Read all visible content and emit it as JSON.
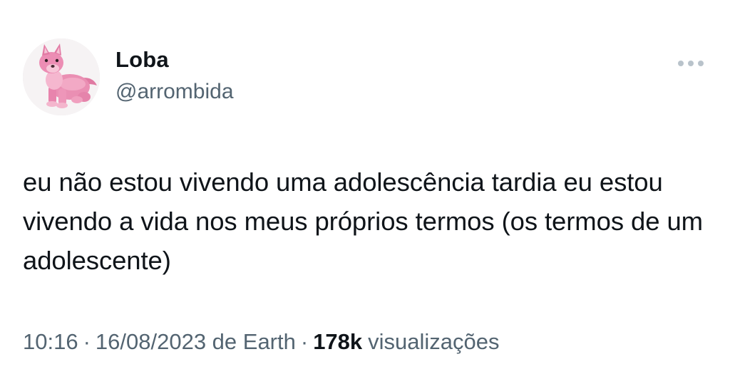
{
  "author": {
    "display_name": "Loba",
    "handle": "@arrombida",
    "avatar_icon": "pink-plush-wolf-avatar"
  },
  "menu": {
    "more_icon": "more-dots-icon"
  },
  "tweet": {
    "text": "eu não estou vivendo uma adolescência tardia eu estou vivendo a vida nos meus próprios termos (os termos de um adolescente)"
  },
  "meta": {
    "time": "10:16",
    "separator": "·",
    "date_source": "16/08/2023 de Earth",
    "views_count": "178k",
    "views_label": "visualizações"
  },
  "colors": {
    "primary_text": "#0f1419",
    "secondary_text": "#536471",
    "background": "#ffffff"
  }
}
